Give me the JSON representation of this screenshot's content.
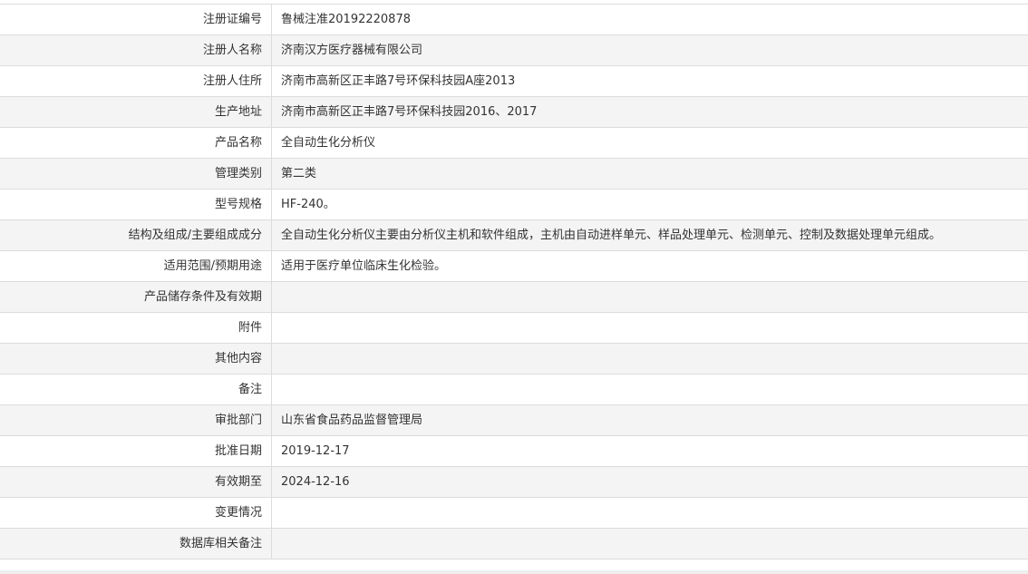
{
  "rows": [
    {
      "label": "注册证编号",
      "value": "鲁械注准20192220878"
    },
    {
      "label": "注册人名称",
      "value": "济南汉方医疗器械有限公司"
    },
    {
      "label": "注册人住所",
      "value": "济南市高新区正丰路7号环保科技园A座2013"
    },
    {
      "label": "生产地址",
      "value": "济南市高新区正丰路7号环保科技园2016、2017"
    },
    {
      "label": "产品名称",
      "value": "全自动生化分析仪"
    },
    {
      "label": "管理类别",
      "value": "第二类"
    },
    {
      "label": "型号规格",
      "value": "HF-240。"
    },
    {
      "label": "结构及组成/主要组成成分",
      "value": "全自动生化分析仪主要由分析仪主机和软件组成，主机由自动进样单元、样品处理单元、检测单元、控制及数据处理单元组成。"
    },
    {
      "label": "适用范围/预期用途",
      "value": "适用于医疗单位临床生化检验。"
    },
    {
      "label": "产品储存条件及有效期",
      "value": ""
    },
    {
      "label": "附件",
      "value": ""
    },
    {
      "label": "其他内容",
      "value": ""
    },
    {
      "label": "备注",
      "value": ""
    },
    {
      "label": "审批部门",
      "value": "山东省食品药品监督管理局"
    },
    {
      "label": "批准日期",
      "value": "2019-12-17"
    },
    {
      "label": "有效期至",
      "value": "2024-12-16"
    },
    {
      "label": "变更情况",
      "value": ""
    },
    {
      "label": "数据库相关备注",
      "value": ""
    }
  ]
}
